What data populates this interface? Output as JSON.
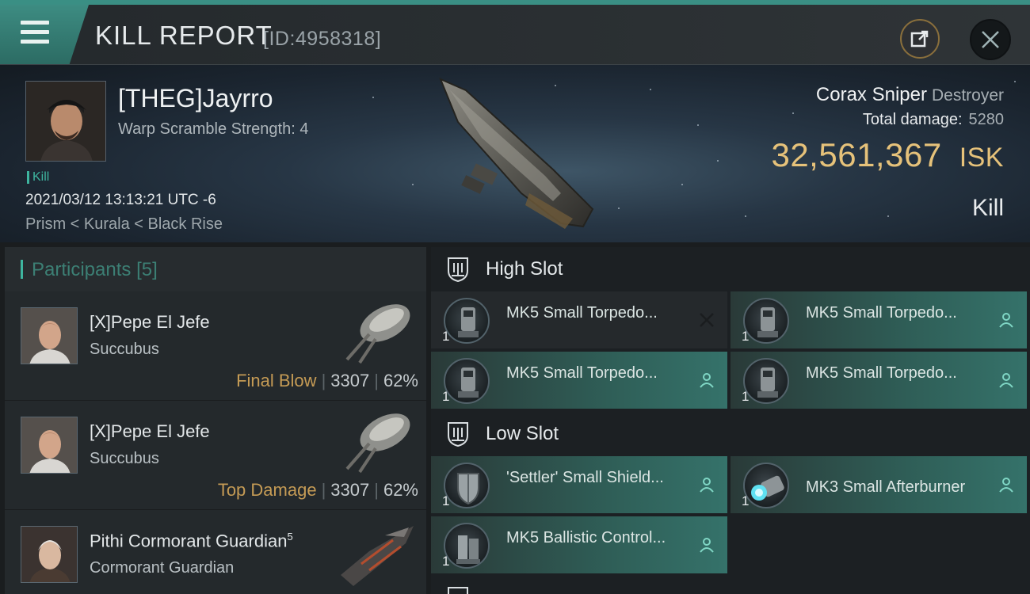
{
  "header": {
    "title": "KILL REPORT",
    "id_label": "[ID:4958318]"
  },
  "victim": {
    "name": "[THEG]Jayrro",
    "warp_scramble": "Warp Scramble Strength: 4",
    "badge": "Kill",
    "datetime": "2021/03/12 13:13:21 UTC -6",
    "location": "Prism < Kurala < Black Rise"
  },
  "ship": {
    "name": "Corax Sniper",
    "class": "Destroyer",
    "total_damage_label": "Total damage:",
    "total_damage_value": "5280",
    "isk_value": "32,561,367",
    "isk_unit": "ISK",
    "status": "Kill"
  },
  "participants": {
    "title": "Participants",
    "count": "[5]",
    "rows": [
      {
        "name": "[X]Pepe El Jefe",
        "ship": "Succubus",
        "tag": "Final Blow",
        "damage": "3307",
        "percent": "62%"
      },
      {
        "name": "[X]Pepe El Jefe",
        "ship": "Succubus",
        "tag": "Top Damage",
        "damage": "3307",
        "percent": "62%"
      },
      {
        "name": "Pithi Cormorant Guardian",
        "level": "5",
        "ship": "Cormorant Guardian"
      }
    ]
  },
  "fitting": {
    "high_slot_label": "High Slot",
    "low_slot_label": "Low Slot",
    "high": [
      {
        "name": "MK5 Small Torpedo...",
        "qty": "1",
        "state": "destroyed",
        "icon": "torpedo-launcher-icon"
      },
      {
        "name": "MK5 Small Torpedo...",
        "qty": "1",
        "state": "dropped",
        "icon": "torpedo-launcher-icon"
      },
      {
        "name": "MK5 Small Torpedo...",
        "qty": "1",
        "state": "dropped",
        "icon": "torpedo-launcher-icon"
      },
      {
        "name": "MK5 Small Torpedo...",
        "qty": "1",
        "state": "dropped",
        "icon": "torpedo-launcher-icon"
      }
    ],
    "low": [
      {
        "name": "'Settler' Small Shield...",
        "qty": "1",
        "state": "dropped",
        "icon": "shield-extender-icon"
      },
      {
        "name": "MK3 Small Afterburner",
        "qty": "1",
        "state": "dropped",
        "icon": "afterburner-icon"
      },
      {
        "name": "MK5 Ballistic Control...",
        "qty": "1",
        "state": "dropped",
        "icon": "ballistic-control-icon"
      }
    ]
  },
  "colors": {
    "accent_teal": "#3eb59f",
    "isk_gold": "#e6c27a",
    "tag_gold": "#c59b55"
  }
}
